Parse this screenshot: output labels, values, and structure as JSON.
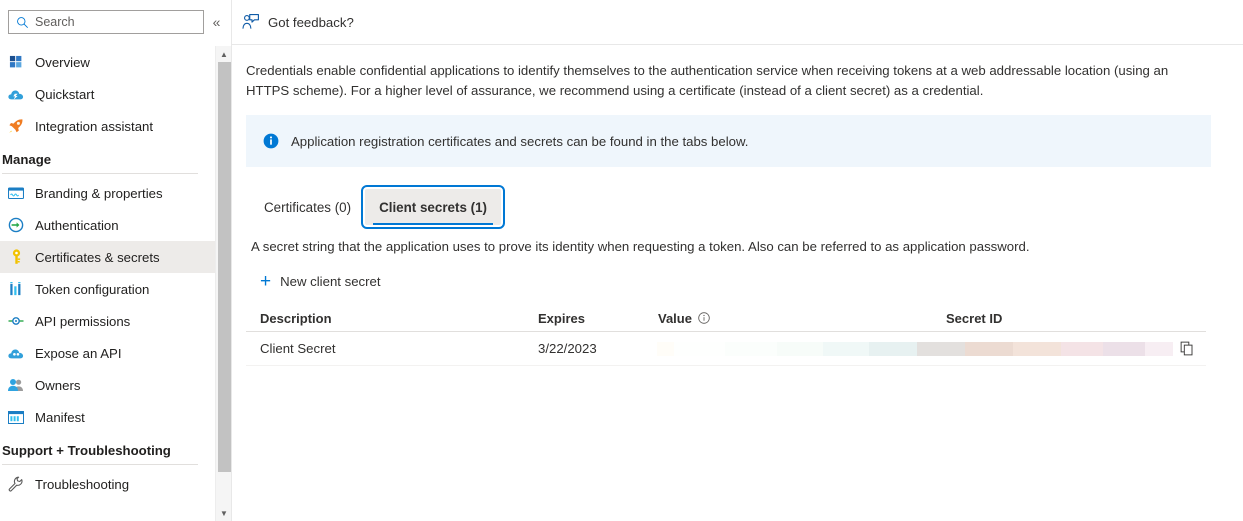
{
  "sidebar": {
    "search": {
      "placeholder": "Search",
      "value": ""
    },
    "collapse_label": "«",
    "items": [
      {
        "label": "Overview",
        "icon": "overview-grid-icon",
        "type": "item",
        "selected": false
      },
      {
        "label": "Quickstart",
        "icon": "quickstart-cloud-icon",
        "type": "item",
        "selected": false
      },
      {
        "label": "Integration assistant",
        "icon": "rocket-icon",
        "type": "item",
        "selected": false
      },
      {
        "label": "Manage",
        "type": "section"
      },
      {
        "label": "Branding & properties",
        "icon": "branding-card-icon",
        "type": "item",
        "selected": false
      },
      {
        "label": "Authentication",
        "icon": "authentication-arrow-icon",
        "type": "item",
        "selected": false
      },
      {
        "label": "Certificates & secrets",
        "icon": "key-icon",
        "type": "item",
        "selected": true
      },
      {
        "label": "Token configuration",
        "icon": "token-bars-icon",
        "type": "item",
        "selected": false
      },
      {
        "label": "API permissions",
        "icon": "api-permissions-icon",
        "type": "item",
        "selected": false
      },
      {
        "label": "Expose an API",
        "icon": "expose-api-cloud-icon",
        "type": "item",
        "selected": false
      },
      {
        "label": "Owners",
        "icon": "owners-people-icon",
        "type": "item",
        "selected": false
      },
      {
        "label": "Manifest",
        "icon": "manifest-icon",
        "type": "item",
        "selected": false
      },
      {
        "label": "Support + Troubleshooting",
        "type": "section"
      },
      {
        "label": "Troubleshooting",
        "icon": "wrench-icon",
        "type": "item",
        "selected": false
      }
    ]
  },
  "header": {
    "feedback_label": "Got feedback?",
    "feedback_icon": "person-feedback-icon"
  },
  "main": {
    "lede": "Credentials enable confidential applications to identify themselves to the authentication service when receiving tokens at a web addressable location (using an HTTPS scheme). For a higher level of assurance, we recommend using a certificate (instead of a client secret) as a credential.",
    "info_banner": {
      "icon": "info-icon",
      "text": "Application registration certificates and secrets can be found in the tabs below."
    },
    "tabs": [
      {
        "label": "Certificates (0)",
        "selected": false,
        "focused": false
      },
      {
        "label": "Client secrets (1)",
        "selected": true,
        "focused": true
      }
    ],
    "tab_description": "A secret string that the application uses to prove its identity when requesting a token. Also can be referred to as application password.",
    "commands": {
      "new_secret_label": "New client secret",
      "new_secret_icon": "plus-icon"
    },
    "table": {
      "columns": [
        "Description",
        "Expires",
        "Value",
        "Secret ID"
      ],
      "value_info_icon": "info-circle-icon",
      "rows": [
        {
          "description": "Client Secret",
          "expires": "3/22/2023",
          "value": "",
          "value_redacted": true,
          "secret_id": "",
          "copy_icon": "copy-icon"
        }
      ]
    }
  },
  "colors": {
    "accent": "#0078d4",
    "info_bg": "#eff6fc",
    "selected_bg": "#edebe9",
    "text": "#323130"
  }
}
